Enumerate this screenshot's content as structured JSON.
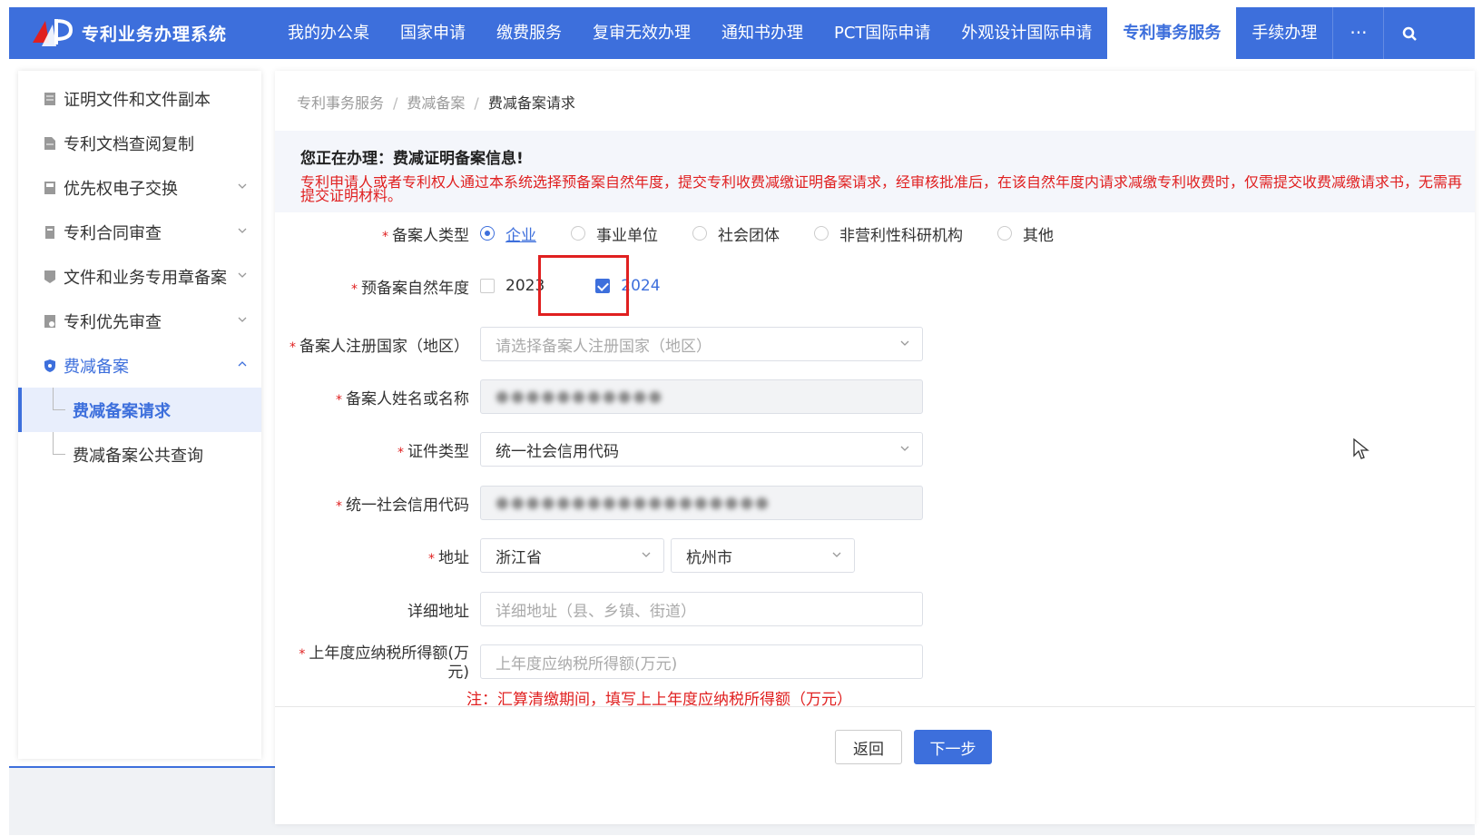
{
  "app": {
    "title": "专利业务办理系统"
  },
  "nav": {
    "items": [
      "我的办公桌",
      "国家申请",
      "缴费服务",
      "复审无效办理",
      "通知书办理",
      "PCT国际申请",
      "外观设计国际申请",
      "专利事务服务",
      "手续办理"
    ],
    "active": "专利事务服务",
    "more": "···"
  },
  "sidebar": {
    "items": [
      {
        "label": "证明文件和文件副本",
        "icon": "document-icon",
        "expandable": false
      },
      {
        "label": "专利文档查阅复制",
        "icon": "document-icon",
        "expandable": false
      },
      {
        "label": "优先权电子交换",
        "icon": "exchange-icon",
        "expandable": true
      },
      {
        "label": "专利合同审查",
        "icon": "contract-icon",
        "expandable": true
      },
      {
        "label": "文件和业务专用章备案",
        "icon": "stamp-icon",
        "expandable": true
      },
      {
        "label": "专利优先审查",
        "icon": "review-icon",
        "expandable": true
      },
      {
        "label": "费减备案",
        "icon": "shield-icon",
        "expandable": true,
        "open": true
      }
    ],
    "subitems": [
      {
        "label": "费减备案请求",
        "active": true
      },
      {
        "label": "费减备案公共查询",
        "active": false
      }
    ]
  },
  "breadcrumb": [
    "专利事务服务",
    "费减备案",
    "费减备案请求"
  ],
  "breadcrumb_sep": "/",
  "notice": {
    "title": "您正在办理：费减证明备案信息!",
    "text": "专利申请人或者专利权人通过本系统选择预备案自然年度，提交专利收费减缴证明备案请求，经审核批准后，在该自然年度内请求减缴专利收费时，仅需提交收费减缴请求书，无需再提交证明材料。"
  },
  "form": {
    "filer_type": {
      "label": "备案人类型",
      "options": [
        "企业",
        "事业单位",
        "社会团体",
        "非营利性科研机构",
        "其他"
      ],
      "selected": "企业"
    },
    "year": {
      "label": "预备案自然年度",
      "options": [
        {
          "label": "2023",
          "checked": false
        },
        {
          "label": "2024",
          "checked": true
        }
      ]
    },
    "country": {
      "label": "备案人注册国家（地区）",
      "placeholder": "请选择备案人注册国家（地区）"
    },
    "name": {
      "label": "备案人姓名或名称",
      "value": "●●●●●●●●●●●"
    },
    "id_type": {
      "label": "证件类型",
      "value": "统一社会信用代码"
    },
    "credit_code": {
      "label": "统一社会信用代码",
      "value": "●●●●●●●●●●●●●●●●●●"
    },
    "address": {
      "label": "地址",
      "province": "浙江省",
      "city": "杭州市"
    },
    "detail_address": {
      "label": "详细地址",
      "placeholder": "详细地址（县、乡镇、街道）"
    },
    "taxable_income": {
      "label_line1": "上年度应纳税所得额(万",
      "label_line2": "元)",
      "placeholder": "上年度应纳税所得额(万元)",
      "hint": "注：汇算清缴期间，填写上上年度应纳税所得额（万元）"
    },
    "required_mark": "*"
  },
  "buttons": {
    "back": "返回",
    "next": "下一步"
  },
  "colors": {
    "brand": "#3d6fdc",
    "error": "#e02020"
  }
}
